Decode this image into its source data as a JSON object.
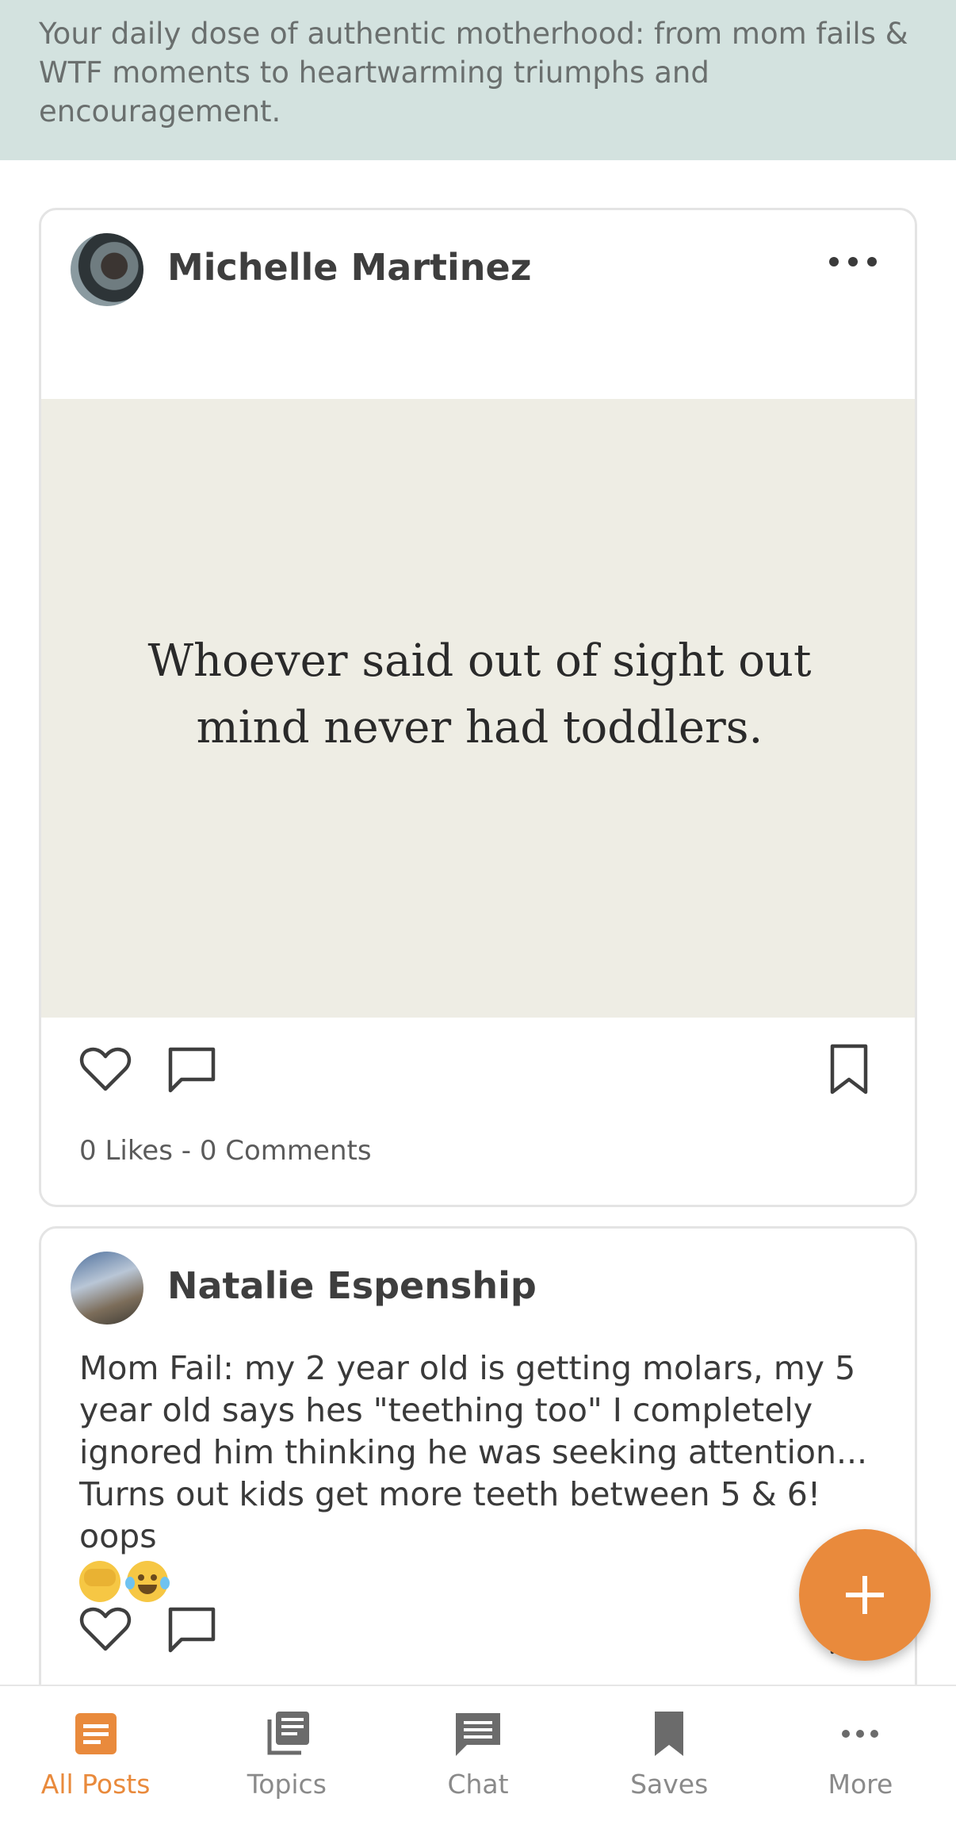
{
  "banner": {
    "description": "Your daily dose of authentic motherhood: from mom fails & WTF moments to heartwarming triumphs and encouragement."
  },
  "posts": [
    {
      "author": "Michelle Martinez",
      "image_text": "Whoever said out of sight out mind never had toddlers.",
      "stats": "0 Likes - 0 Comments"
    },
    {
      "author": "Natalie Espenship",
      "text": "Mom Fail: my 2 year old is getting molars, my 5 year old says hes \"teething too\" I completely ignored him thinking he was seeking attention... Turns out kids get more teeth between 5 & 6!  oops"
    }
  ],
  "nav": {
    "items": [
      {
        "label": "All Posts",
        "icon": "posts-icon",
        "active": true
      },
      {
        "label": "Topics",
        "icon": "topics-icon",
        "active": false
      },
      {
        "label": "Chat",
        "icon": "chat-icon",
        "active": false
      },
      {
        "label": "Saves",
        "icon": "bookmark-icon",
        "active": false
      },
      {
        "label": "More",
        "icon": "more-icon",
        "active": false
      }
    ]
  },
  "colors": {
    "accent": "#e98a3c",
    "banner_bg": "#d3e2df",
    "nav_inactive": "#8a8a8a"
  }
}
